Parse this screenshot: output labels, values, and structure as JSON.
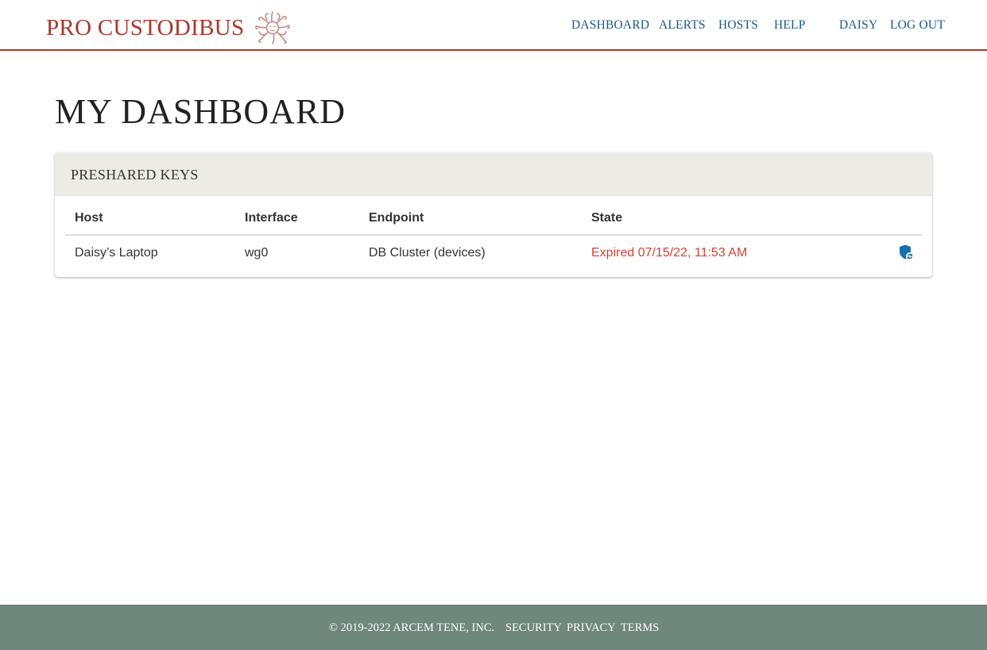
{
  "header": {
    "brand": "PRO CUSTODIBUS",
    "nav": {
      "dashboard": "DASHBOARD",
      "alerts": "ALERTS",
      "hosts": "HOSTS",
      "help": "HELP",
      "user": "DAISY",
      "logout": "LOG OUT"
    },
    "colors": {
      "brand": "#a8372d",
      "link": "#1a5888"
    }
  },
  "main": {
    "title": "MY DASHBOARD",
    "preshared_keys": {
      "title": "PRESHARED KEYS",
      "columns": [
        "Host",
        "Interface",
        "Endpoint",
        "State"
      ],
      "rows": [
        {
          "host": "Daisy’s Laptop",
          "interface": "wg0",
          "endpoint": "DB Cluster (devices)",
          "state": "Expired 07/15/22, 11:53 AM",
          "state_color": "#d6412e",
          "action_icon": "shield-rotate-icon"
        }
      ]
    }
  },
  "footer": {
    "copyright": "© 2019-2022 ARCEM TENE, INC.",
    "links": {
      "security": "SECURITY",
      "privacy": "PRIVACY",
      "terms": "TERMS"
    },
    "background": "#6f877c"
  }
}
